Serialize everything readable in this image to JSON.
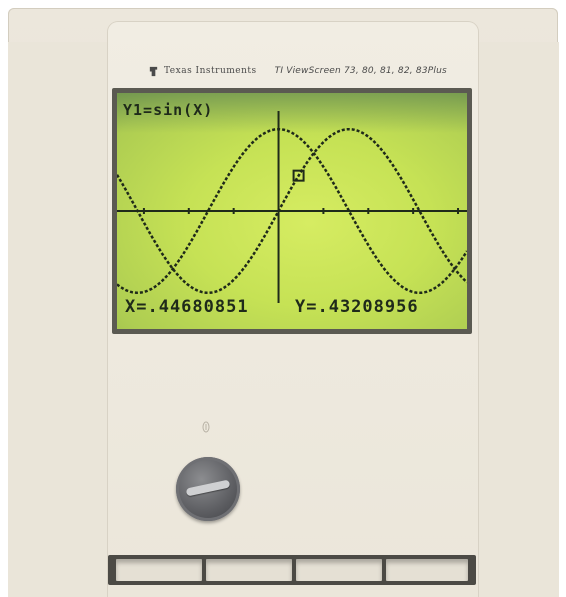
{
  "header": {
    "brand": "Texas Instruments",
    "model": "TI ViewScreen 73, 80, 81, 82, 83Plus"
  },
  "screen": {
    "equation": "Y1=sin(X)",
    "x_readout": "X=.44680851",
    "y_readout": "Y=.43208956",
    "lcd_color": "#c6e255",
    "pixel_color": "#1f2a1a"
  },
  "chart_data": {
    "type": "line",
    "series": [
      {
        "function": "sin(X)",
        "x_range": [
          -3.6,
          4.2
        ]
      },
      {
        "function": "cos(X)",
        "x_range": [
          -3.6,
          4.2
        ]
      }
    ],
    "trace_cursor": {
      "x": 0.44680851,
      "y": 0.43208956
    },
    "grid": false
  },
  "controls": {
    "adjust_knob_icon": "adjustment-knob-icon",
    "indicator_icon": "indicator-mark-icon"
  }
}
